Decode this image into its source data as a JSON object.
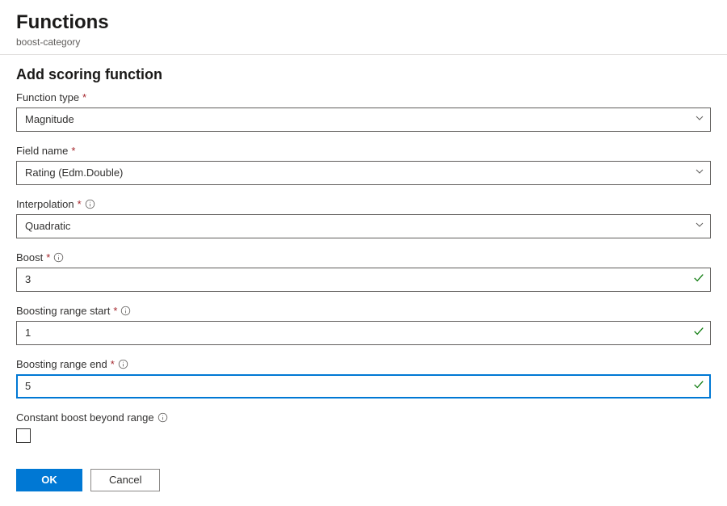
{
  "header": {
    "title": "Functions",
    "subtitle": "boost-category"
  },
  "section_title": "Add scoring function",
  "fields": {
    "function_type": {
      "label": "Function type",
      "value": "Magnitude"
    },
    "field_name": {
      "label": "Field name",
      "value": "Rating (Edm.Double)"
    },
    "interpolation": {
      "label": "Interpolation",
      "value": "Quadratic"
    },
    "boost": {
      "label": "Boost",
      "value": "3"
    },
    "range_start": {
      "label": "Boosting range start",
      "value": "1"
    },
    "range_end": {
      "label": "Boosting range end",
      "value": "5"
    },
    "constant_beyond": {
      "label": "Constant boost beyond range",
      "checked": false
    }
  },
  "buttons": {
    "ok": "OK",
    "cancel": "Cancel"
  }
}
